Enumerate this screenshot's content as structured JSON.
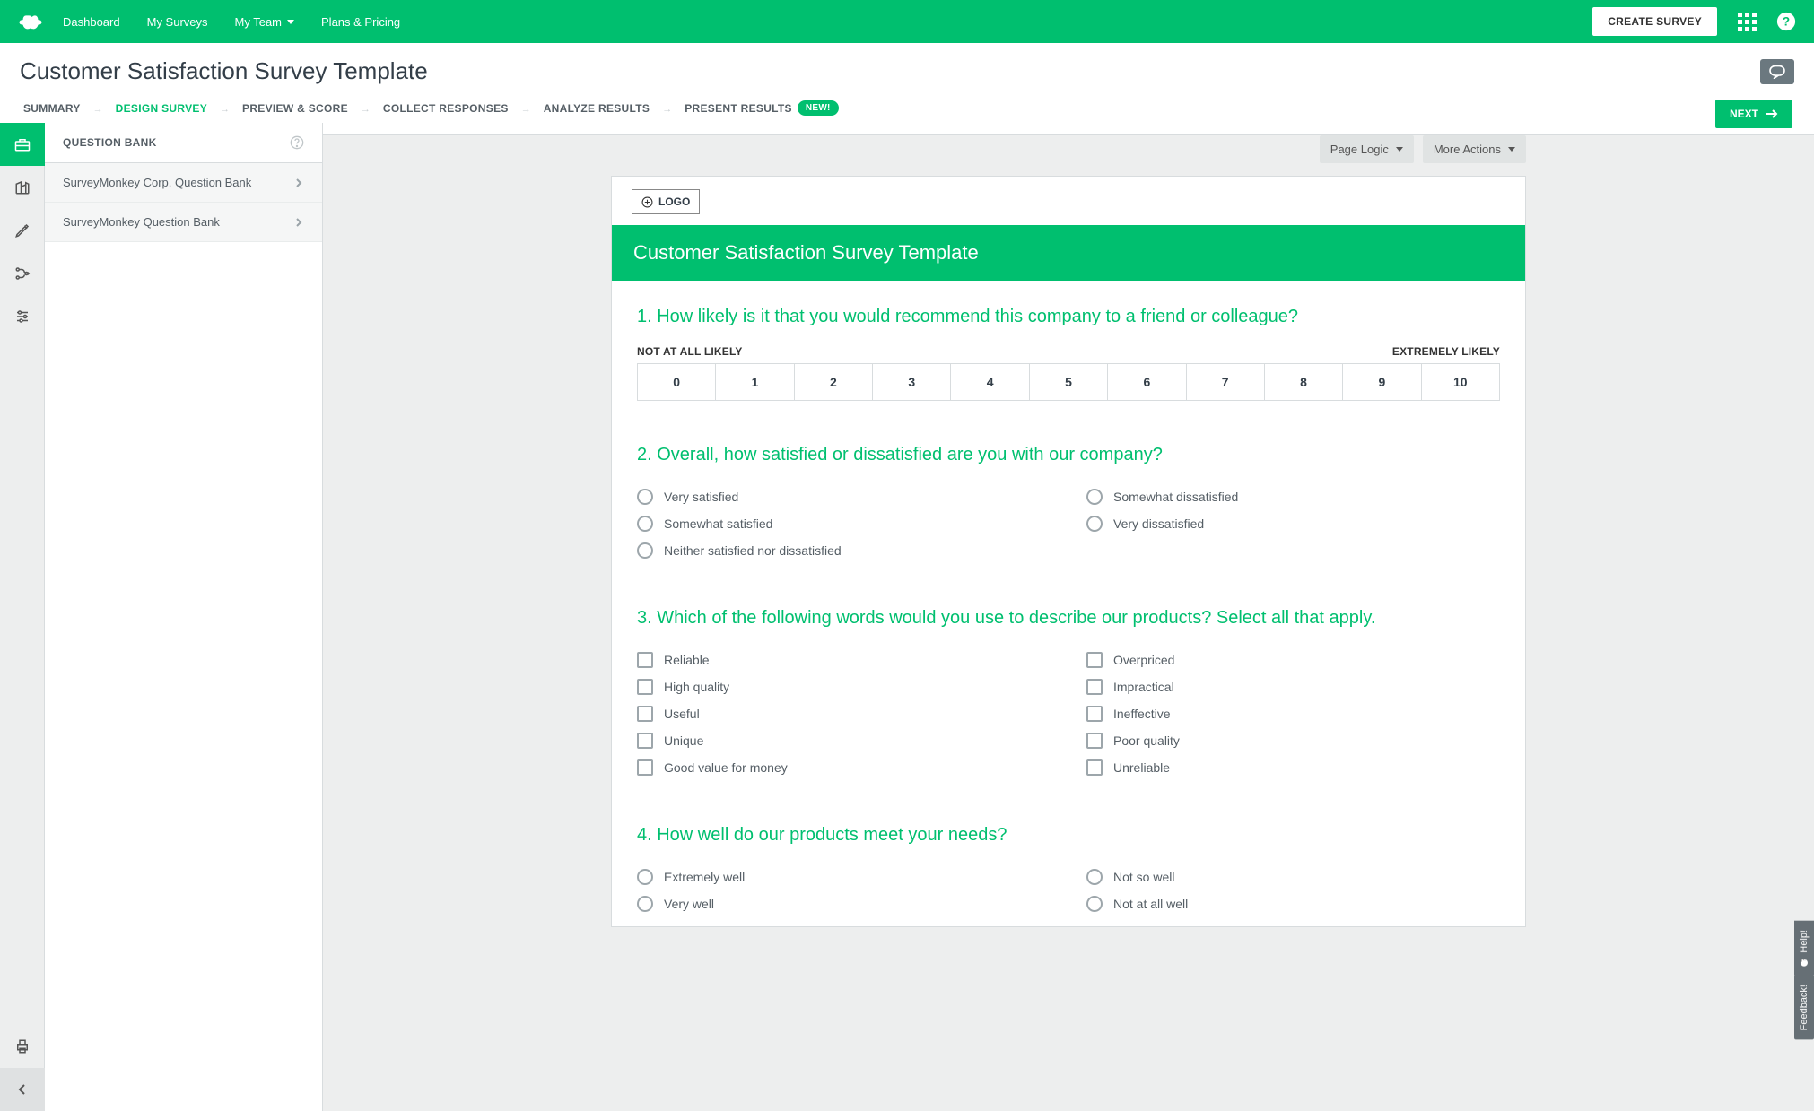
{
  "nav": {
    "dashboard": "Dashboard",
    "my_surveys": "My Surveys",
    "my_team": "My Team",
    "plans": "Plans & Pricing",
    "create_survey": "CREATE SURVEY"
  },
  "title": "Customer Satisfaction Survey Template",
  "steps": {
    "summary": "SUMMARY",
    "design": "DESIGN SURVEY",
    "preview": "PREVIEW & SCORE",
    "collect": "COLLECT RESPONSES",
    "analyze": "ANALYZE RESULTS",
    "present": "PRESENT RESULTS",
    "new_badge": "NEW!",
    "next": "NEXT"
  },
  "sidebar": {
    "header": "QUESTION BANK",
    "items": [
      {
        "label": "SurveyMonkey Corp. Question Bank"
      },
      {
        "label": "SurveyMonkey Question Bank"
      }
    ]
  },
  "page_tools": {
    "logic": "Page Logic",
    "more": "More Actions"
  },
  "survey": {
    "logo_button": "LOGO",
    "title": "Customer Satisfaction Survey Template",
    "q1": {
      "title": "1. How likely is it that you would recommend this company to a friend or colleague?",
      "low_label": "NOT AT ALL LIKELY",
      "high_label": "EXTREMELY LIKELY",
      "scale": [
        "0",
        "1",
        "2",
        "3",
        "4",
        "5",
        "6",
        "7",
        "8",
        "9",
        "10"
      ]
    },
    "q2": {
      "title": "2. Overall, how satisfied or dissatisfied are you with our company?",
      "options_left": [
        "Very satisfied",
        "Somewhat satisfied",
        "Neither satisfied nor dissatisfied"
      ],
      "options_right": [
        "Somewhat dissatisfied",
        "Very dissatisfied"
      ]
    },
    "q3": {
      "title": "3. Which of the following words would you use to describe our products? Select all that apply.",
      "options_left": [
        "Reliable",
        "High quality",
        "Useful",
        "Unique",
        "Good value for money"
      ],
      "options_right": [
        "Overpriced",
        "Impractical",
        "Ineffective",
        "Poor quality",
        "Unreliable"
      ]
    },
    "q4": {
      "title": "4. How well do our products meet your needs?",
      "options_left": [
        "Extremely well",
        "Very well"
      ],
      "options_right": [
        "Not so well",
        "Not at all well"
      ]
    }
  },
  "float": {
    "help": "Help!",
    "feedback": "Feedback!"
  }
}
